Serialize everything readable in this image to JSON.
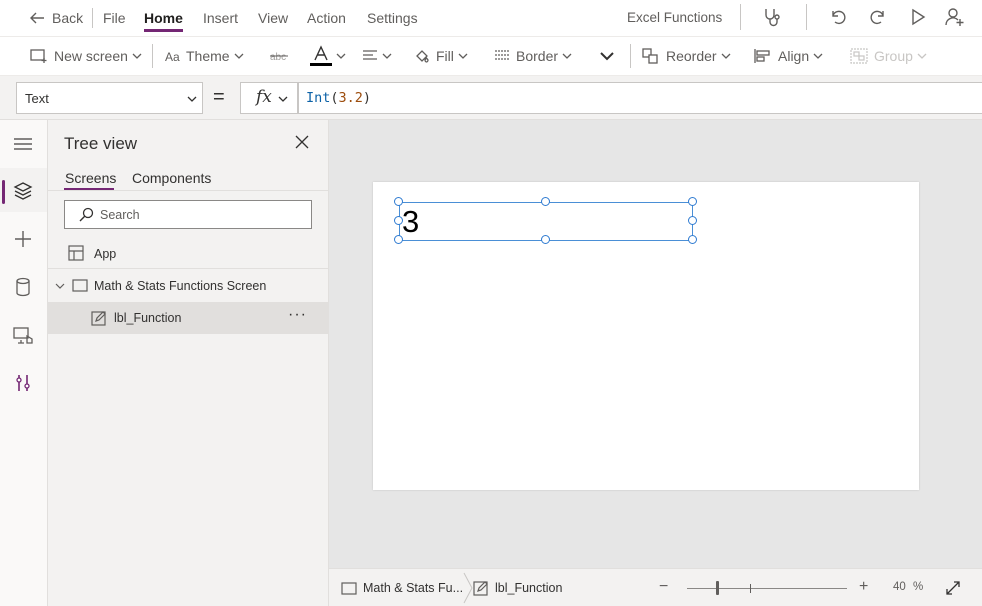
{
  "menubar": {
    "back_label": "Back",
    "items": [
      {
        "label": "File"
      },
      {
        "label": "Home"
      },
      {
        "label": "Insert"
      },
      {
        "label": "View"
      },
      {
        "label": "Action"
      },
      {
        "label": "Settings"
      }
    ],
    "active_item": "Home",
    "app_title": "Excel Functions"
  },
  "ribbon": {
    "new_screen": "New screen",
    "theme": "Theme",
    "fill": "Fill",
    "border": "Border",
    "reorder": "Reorder",
    "align": "Align",
    "group": "Group"
  },
  "formula": {
    "property": "Text",
    "equals": "=",
    "fx": "fx",
    "function_name": "Int",
    "open_paren": "(",
    "argument": "3.2",
    "close_paren": ")"
  },
  "tree": {
    "title": "Tree view",
    "tabs": [
      {
        "label": "Screens"
      },
      {
        "label": "Components"
      }
    ],
    "search_placeholder": "Search",
    "app_label": "App",
    "screen_label": "Math & Stats Functions Screen",
    "control_label": "lbl_Function",
    "more_label": "···"
  },
  "canvas": {
    "label_value": "3"
  },
  "statusbar": {
    "screen_crumb": "Math & Stats Fu...",
    "control_crumb": "lbl_Function",
    "zoom_value": "40",
    "zoom_unit": "%",
    "zoom_minus": "−",
    "zoom_plus": "+"
  },
  "colors": {
    "accent": "#742774",
    "selection": "#4a8fd6",
    "canvas_bg": "#e6e6e6",
    "panel_bg": "#f3f2f1"
  }
}
